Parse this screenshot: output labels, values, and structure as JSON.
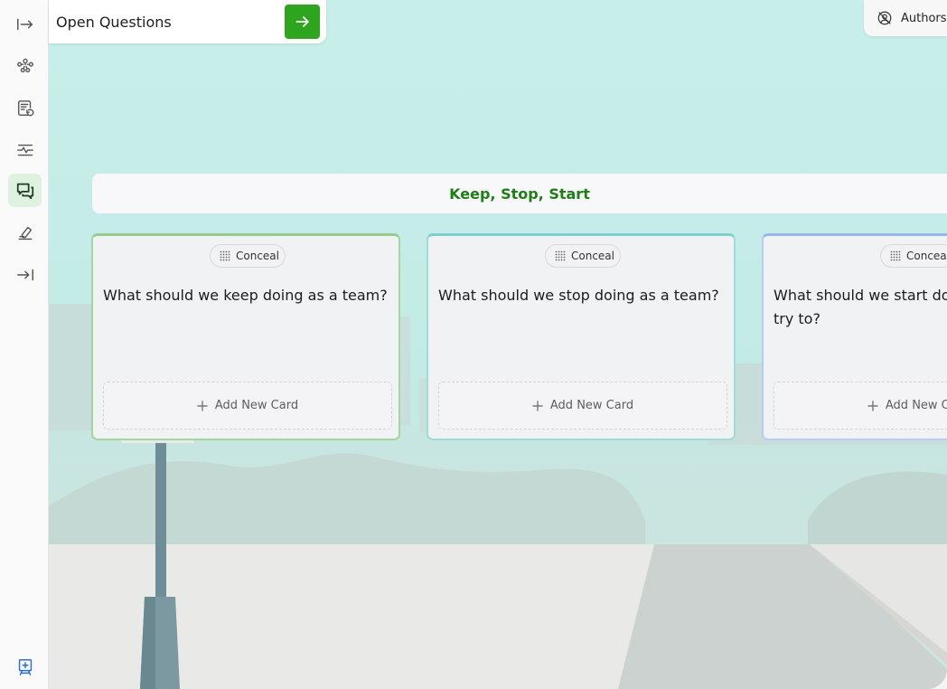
{
  "topic": {
    "title": "Open Questions"
  },
  "authors": {
    "label": "Authors"
  },
  "board": {
    "title": "Keep, Stop, Start"
  },
  "columns": [
    {
      "conceal_label": "Conceal",
      "question": "What should we keep doing as a team?",
      "add_label": "Add New Card",
      "accent": "#95cc8e"
    },
    {
      "conceal_label": "Conceal",
      "question": "What should we stop doing as a team?",
      "add_label": "Add New Card",
      "accent": "#7ecfcb"
    },
    {
      "conceal_label": "Conceal",
      "question": "What should we start doing, or at least try to?",
      "add_label": "Add New Card",
      "accent": "#95b6ec"
    }
  ],
  "sidebar": {
    "items": [
      {
        "icon": "expand-right-icon"
      },
      {
        "icon": "workflow-icon"
      },
      {
        "icon": "board-history-icon"
      },
      {
        "icon": "activity-icon"
      },
      {
        "icon": "chat-icon",
        "active": true
      },
      {
        "icon": "eraser-icon"
      },
      {
        "icon": "collapse-right-icon"
      },
      {
        "icon": "add-board-icon"
      }
    ]
  },
  "colors": {
    "accent_green": "#2fa51f",
    "title_green": "#1e7d14"
  }
}
